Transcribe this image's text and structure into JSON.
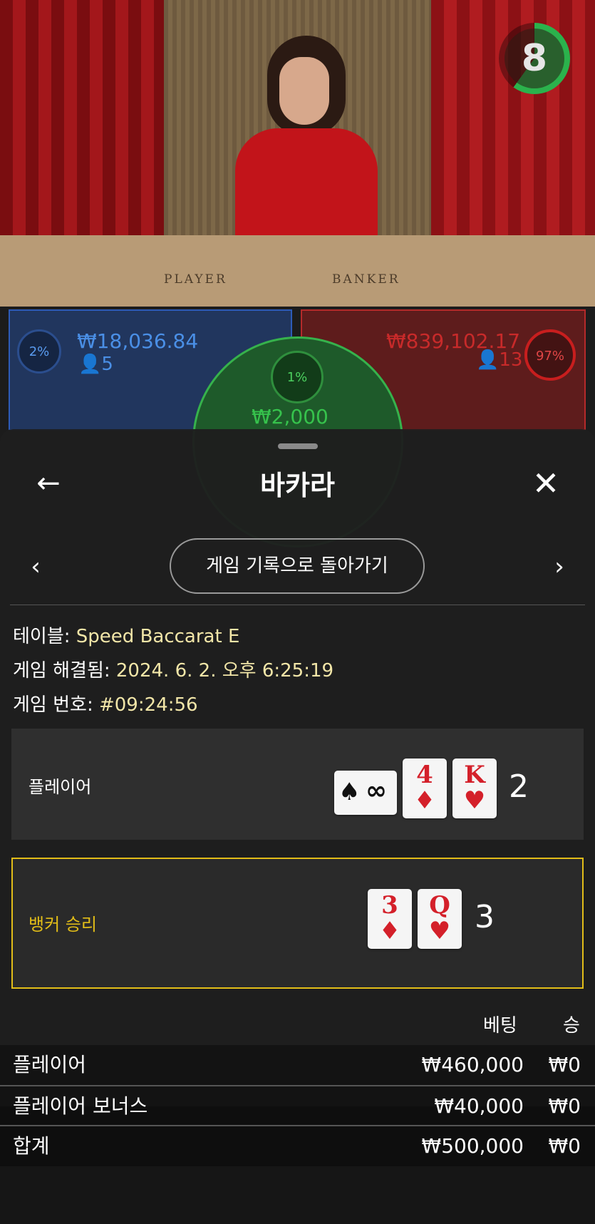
{
  "video": {
    "timer": "8",
    "felt_labels": [
      "PLAYER",
      "BANKER"
    ]
  },
  "board": {
    "player": {
      "percent": "2%",
      "amount": "₩18,036.84",
      "count": "5"
    },
    "banker": {
      "percent": "97%",
      "amount": "₩839,102.17",
      "count": "13"
    },
    "tie": {
      "percent": "1%",
      "amount": "₩2,000"
    }
  },
  "sheet": {
    "title": "바카라",
    "back_icon": "←",
    "close_icon": "✕",
    "prev_icon": "‹",
    "next_icon": "›",
    "return_button": "게임 기록으로 돌아가기",
    "info": [
      {
        "label": "테이블: ",
        "value": "Speed Baccarat E"
      },
      {
        "label": "게임 해결됨: ",
        "value": "2024. 6. 2. 오후 6:25:19"
      },
      {
        "label": "게임 번호: ",
        "value": "#09:24:56"
      }
    ],
    "player_hand": {
      "label": "플레이어",
      "lightning_card": {
        "suit": "♠",
        "symbol": "∞"
      },
      "cards": [
        {
          "rank": "4",
          "suit": "♦"
        },
        {
          "rank": "K",
          "suit": "♥"
        }
      ],
      "score": "2"
    },
    "banker_hand": {
      "label": "뱅커 승리",
      "cards": [
        {
          "rank": "3",
          "suit": "♦"
        },
        {
          "rank": "Q",
          "suit": "♥"
        }
      ],
      "score": "3"
    },
    "table": {
      "headers": {
        "bet": "베팅",
        "win": "승"
      },
      "rows": [
        {
          "name": "플레이어",
          "bet": "₩460,000",
          "win": "₩0"
        },
        {
          "name": "플레이어 보너스",
          "bet": "₩40,000",
          "win": "₩0"
        },
        {
          "name": "합계",
          "bet": "₩500,000",
          "win": "₩0"
        }
      ]
    }
  },
  "colors": {
    "accent_yellow": "#e2bd18",
    "player_blue": "#2d5bb8",
    "banker_red": "#b52a2a",
    "tie_green": "#36b24c"
  }
}
